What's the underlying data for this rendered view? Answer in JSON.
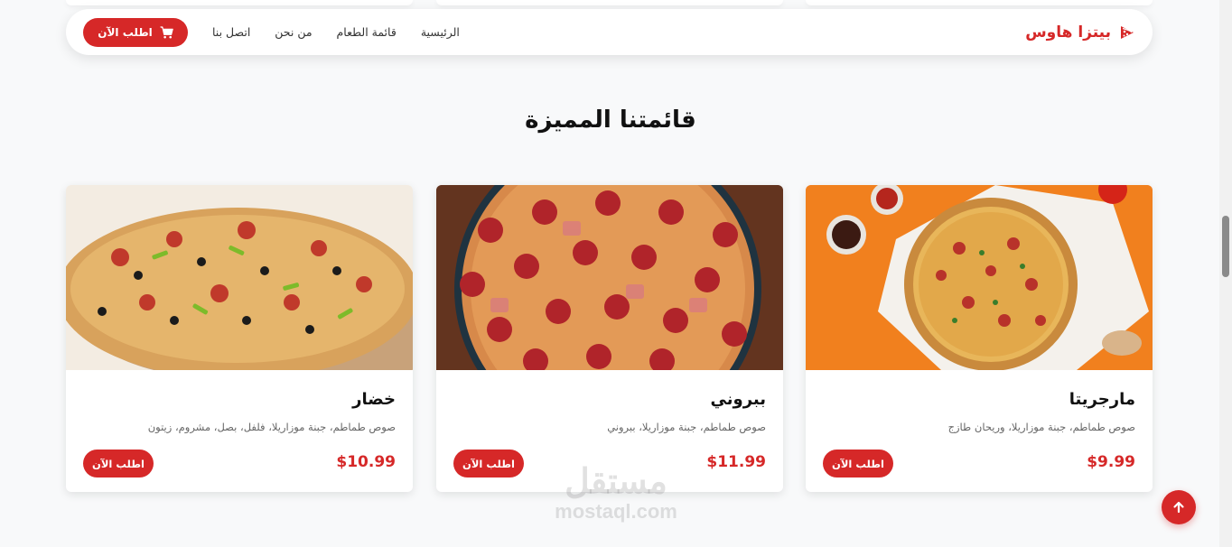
{
  "navbar": {
    "brand": "بيتزا هاوس",
    "links": [
      "الرئيسية",
      "قائمة الطعام",
      "من نحن",
      "اتصل بنا"
    ],
    "order_button": "اطلب الآن"
  },
  "menu_section": {
    "title": "قائمتنا المميزة",
    "items": [
      {
        "name": "مارجريتا",
        "description": "صوص طماطم، جبنة موزاريلا، وريحان طازج",
        "price": "$9.99",
        "button": "اطلب الآن",
        "image": "pizza-margherita-image"
      },
      {
        "name": "ببروني",
        "description": "صوص طماطم، جبنة موزاريلا، ببروني",
        "price": "$11.99",
        "button": "اطلب الآن",
        "image": "pizza-pepperoni-image"
      },
      {
        "name": "خضار",
        "description": "صوص طماطم، جبنة موزاريلا، فلفل، بصل، مشروم، زيتون",
        "price": "$10.99",
        "button": "اطلب الآن",
        "image": "pizza-vegetable-image"
      }
    ]
  },
  "watermark": {
    "arabic": "مستقل",
    "latin": "mostaql.com"
  },
  "icons": {
    "brand": "pizza-slice-icon",
    "cart": "cart-icon",
    "back_to_top": "arrow-up-icon"
  },
  "colors": {
    "accent": "#d62828",
    "background": "#f8f9fa"
  }
}
